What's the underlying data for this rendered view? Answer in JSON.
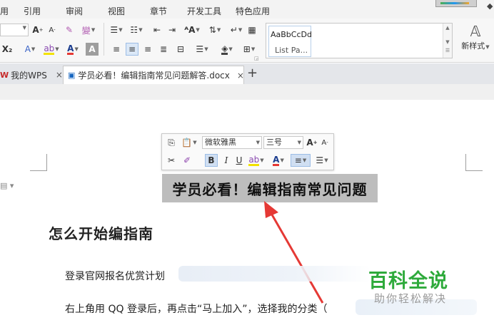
{
  "menu": {
    "items": [
      {
        "label": "用"
      },
      {
        "label": "引用"
      },
      {
        "label": "审阅"
      },
      {
        "label": "视图"
      },
      {
        "label": "章节"
      },
      {
        "label": "开发工具"
      },
      {
        "label": "特色应用"
      }
    ]
  },
  "ribbon": {
    "font_size_value": "",
    "grow_font": "A",
    "shrink_font": "A",
    "subscript": "X₂",
    "text_effect": "A",
    "highlight": "ab",
    "font_color": "A",
    "char_shade": "A",
    "styles": [
      {
        "sample": "AaBbCcDd",
        "name": "List Pa..."
      }
    ],
    "new_style_label": "新样式"
  },
  "tabs": {
    "items": [
      {
        "label": "我的WPS",
        "close": "×"
      },
      {
        "label": "学员必看！编辑指南常见问题解答.docx",
        "close": "×"
      }
    ],
    "new_tab": "+"
  },
  "float_toolbar": {
    "font_name": "微软雅黑",
    "font_size": "三号",
    "grow": "A",
    "shrink": "A",
    "bold": "B",
    "italic": "I",
    "underline": "U",
    "highlight": "ab",
    "font_color": "A"
  },
  "document": {
    "title": "学员必看！编辑指南常见问题",
    "heading": "怎么开始编指南",
    "para1": "登录官网报名优赏计划",
    "para2": "右上角用 QQ 登录后，再点击“马上加入”，选择我的分类（"
  },
  "watermark": {
    "brand": "百科全说",
    "tagline": "助你轻松解决"
  },
  "colors": {
    "accent": "#2eaa3b",
    "arrow": "#e53935",
    "selection": "#bdbdbd"
  }
}
